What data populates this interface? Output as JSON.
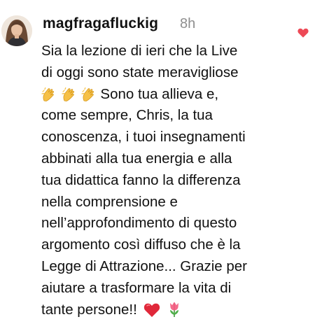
{
  "comment": {
    "username": "magfragafluckig",
    "timestamp": "8h",
    "lines": [
      "Sia la lezione di ieri che la Live",
      "di oggi sono state meravigliose",
      "Sono tua allieva e,",
      "come sempre, Chris, la tua",
      "conoscenza, i tuoi insegnamenti",
      "abbinati alla tua energia e alla",
      "tua didattica fanno la differenza",
      "nella comprensione e",
      "nell’approfondimento di questo",
      "argomento così diffuso che è la",
      "Legge di Attrazione... Grazie per",
      "aiutare a trasformare la vita di",
      "tante persone!!"
    ],
    "emojis": {
      "clapping": "clapping-hands-emoji",
      "heart": "red-heart-emoji",
      "tulip": "tulip-emoji"
    },
    "like_icon": "heart-icon",
    "colors": {
      "like": "#ed4956",
      "timestamp": "#8e8e8e",
      "text": "#111111"
    }
  }
}
